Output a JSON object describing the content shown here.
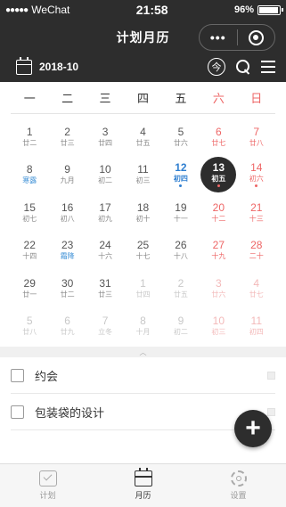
{
  "status_bar": {
    "signal": "●●●●●",
    "carrier": "WeChat",
    "time": "21:58",
    "battery": "96%",
    "battery_level": 0.96
  },
  "navbar": {
    "title": "计划月历",
    "more_glyph": "•••"
  },
  "toolbar": {
    "date": "2018-10",
    "today_label": "今"
  },
  "calendar": {
    "weekdays": [
      "一",
      "二",
      "三",
      "四",
      "五",
      "六",
      "日"
    ],
    "weeks": [
      [
        {
          "n": "1",
          "l": "廿二"
        },
        {
          "n": "2",
          "l": "廿三"
        },
        {
          "n": "3",
          "l": "廿四"
        },
        {
          "n": "4",
          "l": "廿五"
        },
        {
          "n": "5",
          "l": "廿六"
        },
        {
          "n": "6",
          "l": "廿七"
        },
        {
          "n": "7",
          "l": "廿八"
        }
      ],
      [
        {
          "n": "8",
          "l": "寒露",
          "term": true
        },
        {
          "n": "9",
          "l": "九月"
        },
        {
          "n": "10",
          "l": "初二"
        },
        {
          "n": "11",
          "l": "初三"
        },
        {
          "n": "12",
          "l": "初四",
          "blue": true,
          "dot": true
        },
        {
          "n": "13",
          "l": "初五",
          "sel": true,
          "dot": true
        },
        {
          "n": "14",
          "l": "初六",
          "dot": true
        }
      ],
      [
        {
          "n": "15",
          "l": "初七"
        },
        {
          "n": "16",
          "l": "初八"
        },
        {
          "n": "17",
          "l": "初九"
        },
        {
          "n": "18",
          "l": "初十"
        },
        {
          "n": "19",
          "l": "十一"
        },
        {
          "n": "20",
          "l": "十二"
        },
        {
          "n": "21",
          "l": "十三"
        }
      ],
      [
        {
          "n": "22",
          "l": "十四"
        },
        {
          "n": "23",
          "l": "霜降",
          "term": true
        },
        {
          "n": "24",
          "l": "十六"
        },
        {
          "n": "25",
          "l": "十七"
        },
        {
          "n": "26",
          "l": "十八"
        },
        {
          "n": "27",
          "l": "十九"
        },
        {
          "n": "28",
          "l": "二十"
        }
      ],
      [
        {
          "n": "29",
          "l": "廿一"
        },
        {
          "n": "30",
          "l": "廿二"
        },
        {
          "n": "31",
          "l": "廿三"
        },
        {
          "n": "1",
          "l": "廿四",
          "out": true
        },
        {
          "n": "2",
          "l": "廿五",
          "out": true
        },
        {
          "n": "3",
          "l": "廿六",
          "out": true
        },
        {
          "n": "4",
          "l": "廿七",
          "out": true
        }
      ],
      [
        {
          "n": "5",
          "l": "廿八",
          "out": true
        },
        {
          "n": "6",
          "l": "廿九",
          "out": true
        },
        {
          "n": "7",
          "l": "立冬",
          "out": true
        },
        {
          "n": "8",
          "l": "十月",
          "out": true
        },
        {
          "n": "9",
          "l": "初二",
          "out": true
        },
        {
          "n": "10",
          "l": "初三",
          "out": true
        },
        {
          "n": "11",
          "l": "初四",
          "out": true
        }
      ]
    ]
  },
  "collapse_glyph": "︿",
  "tasks": [
    {
      "label": "约会",
      "checked": false
    },
    {
      "label": "包装袋的设计",
      "checked": false
    }
  ],
  "fab_label": "+",
  "tabbar": [
    {
      "label": "计划",
      "icon": "check-icon",
      "active": false
    },
    {
      "label": "月历",
      "icon": "calendar-icon",
      "active": true
    },
    {
      "label": "设置",
      "icon": "gear-icon",
      "active": false
    }
  ],
  "colors": {
    "dark": "#2d2d2d",
    "weekend": "#e66666",
    "accent": "#2f7fd0"
  }
}
